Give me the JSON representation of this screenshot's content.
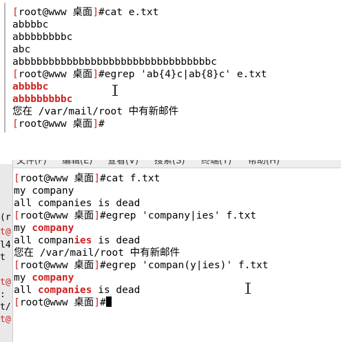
{
  "prompt": {
    "lbr": "[",
    "user": "root@www",
    "dir": "桌面",
    "rbr": "]",
    "sym": "#"
  },
  "term1": {
    "l0_cmd": "cat e.txt",
    "l1": "abbbbc",
    "l2": "abbbbbbbbc",
    "l3": "abc",
    "l4": "abbbbbbbbbbbbbbbbbbbbbbbbbbbbbbbbc",
    "l5_cmd": "egrep 'ab{4}c|ab{8}c' e.txt",
    "l6_match": "abbbbc",
    "l7_match": "abbbbbbbbc",
    "l8_mail": "您在 /var/mail/root 中有新邮件"
  },
  "term2": {
    "menu": [
      "文件(F)",
      "编辑(E)",
      "查看(V)",
      "搜索(S)",
      "终端(T)",
      "帮助(H)"
    ],
    "l0_cmd": "cat f.txt",
    "l1": "my company",
    "l2": "all companies is dead",
    "l3_cmd": "egrep 'company|ies' f.txt",
    "l4_pre": "my ",
    "l4_hl": "company",
    "l5_pre": "all compan",
    "l5_hl": "ies",
    "l5_post": " is dead",
    "l6_mail": "您在 /var/mail/root 中有新邮件",
    "l7_cmd": "egrep 'compan(y|ies)' f.txt",
    "l8_pre": "my ",
    "l8_hl": "company",
    "l9_pre": "all ",
    "l9_hl": "companies",
    "l9_post": " is dead"
  },
  "background_fragments": [
    "(r",
    "t@",
    "l4",
    "t",
    "t@",
    ":",
    "t/",
    "t@"
  ],
  "colors": {
    "prompt": "#cc2222",
    "match": "#cc2222",
    "text": "#000000",
    "bg": "#ffffff"
  }
}
